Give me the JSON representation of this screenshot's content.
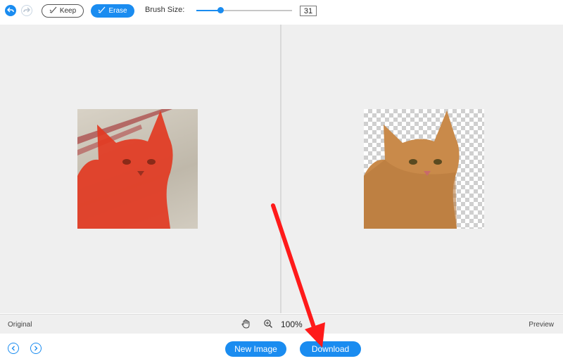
{
  "toolbar": {
    "undo_icon": "undo-icon",
    "redo_icon": "redo-icon",
    "keep_label": "Keep",
    "erase_label": "Erase",
    "brush_size_label": "Brush Size:",
    "brush_size_value": "31",
    "brush_slider_fraction": 0.25,
    "accent_color": "#1a8cf0"
  },
  "canvas": {
    "original_label": "Original",
    "preview_label": "Preview",
    "zoom_level": "100%"
  },
  "bottom": {
    "new_image_label": "New Image",
    "download_label": "Download"
  },
  "annotation": {
    "arrow_color": "#ff1a1a"
  }
}
